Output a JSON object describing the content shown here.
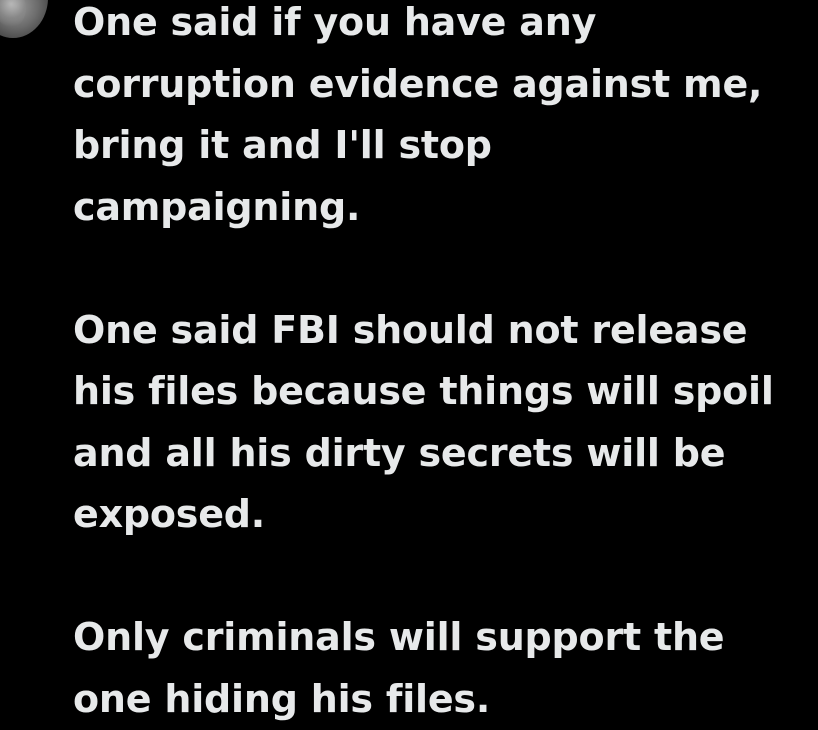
{
  "post": {
    "paragraphs": [
      "One said if you have any\ncorruption evidence against me,\nbring it and I'll stop\ncampaigning.",
      "One said FBI should not release\nhis files because things will spoil\nand all his dirty secrets will be\nexposed.",
      "Only criminals will support the\none hiding his files."
    ]
  },
  "colors": {
    "background": "#000000",
    "text": "#e7e9ea"
  },
  "icons": {
    "avatar": "user-avatar"
  }
}
